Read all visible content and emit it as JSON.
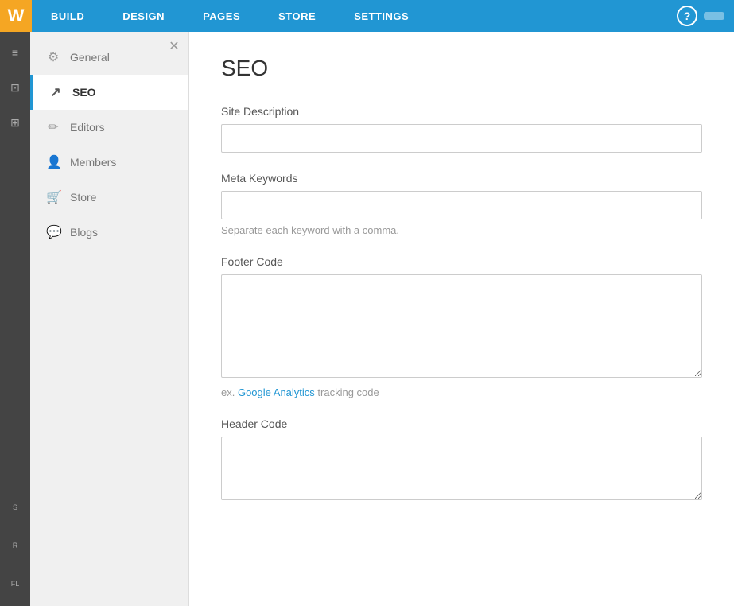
{
  "brand": {
    "logo_text": "W"
  },
  "top_nav": {
    "items": [
      {
        "id": "build",
        "label": "BUILD"
      },
      {
        "id": "design",
        "label": "DESIGN"
      },
      {
        "id": "pages",
        "label": "PAGES"
      },
      {
        "id": "store",
        "label": "STORE"
      },
      {
        "id": "settings",
        "label": "SETTINGS"
      }
    ],
    "help_label": "?",
    "active": "settings"
  },
  "left_sidebar": {
    "items": [
      {
        "id": "item1",
        "icon": "≡",
        "label": ""
      },
      {
        "id": "item2",
        "icon": "◻",
        "label": ""
      },
      {
        "id": "item3",
        "icon": "⊞",
        "label": ""
      },
      {
        "id": "item4",
        "icon": "↩",
        "label": "S"
      },
      {
        "id": "item5",
        "icon": "R",
        "label": "R"
      },
      {
        "id": "item6",
        "icon": "FL",
        "label": "FL"
      }
    ]
  },
  "settings_nav": {
    "items": [
      {
        "id": "general",
        "label": "General",
        "icon": "⚙",
        "active": false
      },
      {
        "id": "seo",
        "label": "SEO",
        "icon": "⤴",
        "active": true
      },
      {
        "id": "editors",
        "label": "Editors",
        "icon": "✏",
        "active": false
      },
      {
        "id": "members",
        "label": "Members",
        "icon": "👤",
        "active": false
      },
      {
        "id": "store",
        "label": "Store",
        "icon": "🛒",
        "active": false
      },
      {
        "id": "blogs",
        "label": "Blogs",
        "icon": "💬",
        "active": false
      }
    ]
  },
  "content": {
    "page_title": "SEO",
    "form": {
      "site_description_label": "Site Description",
      "site_description_value": "",
      "site_description_placeholder": "",
      "meta_keywords_label": "Meta Keywords",
      "meta_keywords_value": "",
      "meta_keywords_placeholder": "",
      "meta_keywords_hint": "Separate each keyword with a comma.",
      "footer_code_label": "Footer Code",
      "footer_code_value": "",
      "footer_code_hint_prefix": "ex. ",
      "footer_code_hint_link_text": "Google Analytics",
      "footer_code_hint_link_url": "#",
      "footer_code_hint_suffix": " tracking code",
      "header_code_label": "Header Code",
      "header_code_value": ""
    }
  }
}
